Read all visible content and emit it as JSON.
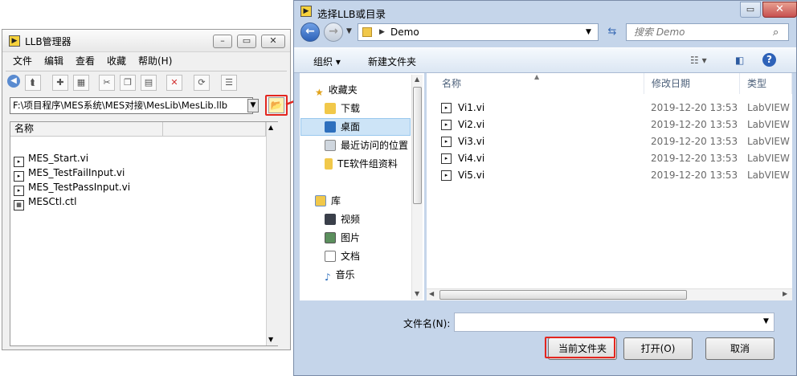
{
  "llb": {
    "title": "LLB管理器",
    "menu": [
      "文件",
      "编辑",
      "查看",
      "收藏",
      "帮助(H)"
    ],
    "path": "F:\\项目程序\\MES系统\\MES对接\\MesLib\\MesLib.llb",
    "column_name": "名称",
    "files": [
      "MES_Start.vi",
      "MES_TestFailInput.vi",
      "MES_TestPassInput.vi",
      "MESCtl.ctl"
    ]
  },
  "dialog": {
    "title": "选择LLB或目录",
    "address": "Demo",
    "search_placeholder": "搜索 Demo",
    "organize": "组织 ▾",
    "new_folder": "新建文件夹",
    "nav": {
      "favorites": "收藏夹",
      "downloads": "下载",
      "desktop": "桌面",
      "recent": "最近访问的位置",
      "te": "TE软件组资料",
      "library": "库",
      "videos": "视频",
      "pictures": "图片",
      "documents": "文档",
      "music": "音乐"
    },
    "columns": {
      "name": "名称",
      "date": "修改日期",
      "type": "类型"
    },
    "files": [
      {
        "name": "Vi1.vi",
        "date": "2019-12-20 13:53",
        "type": "LabVIEW"
      },
      {
        "name": "Vi2.vi",
        "date": "2019-12-20 13:53",
        "type": "LabVIEW"
      },
      {
        "name": "Vi3.vi",
        "date": "2019-12-20 13:53",
        "type": "LabVIEW"
      },
      {
        "name": "Vi4.vi",
        "date": "2019-12-20 13:53",
        "type": "LabVIEW"
      },
      {
        "name": "Vi5.vi",
        "date": "2019-12-20 13:53",
        "type": "LabVIEW"
      }
    ],
    "filename_label": "文件名(N):",
    "filename_value": "",
    "btn_current": "当前文件夹",
    "btn_open": "打开(O)",
    "btn_cancel": "取消"
  },
  "colors": {
    "annotation": "#e3261f",
    "selected": "#cde4f7"
  }
}
